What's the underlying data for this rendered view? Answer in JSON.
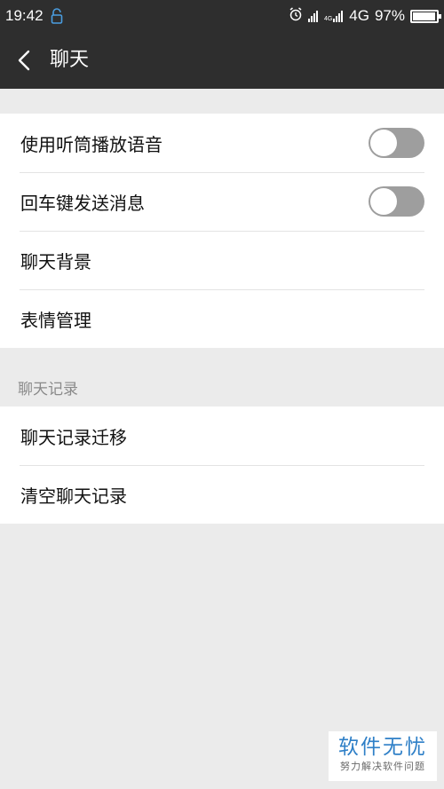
{
  "status_bar": {
    "time": "19:42",
    "network": "4G",
    "tiny_network": "4G",
    "battery": "97%",
    "battery_level": 0.97,
    "icons": [
      "lock-icon",
      "alarm-icon",
      "signal-icon",
      "signal-icon",
      "battery-icon"
    ]
  },
  "header": {
    "title": "聊天",
    "back_icon": "chevron-left-icon"
  },
  "settings": {
    "items": [
      {
        "label": "使用听筒播放语音",
        "toggle": false
      },
      {
        "label": "回车键发送消息",
        "toggle": false
      },
      {
        "label": "聊天背景"
      },
      {
        "label": "表情管理"
      }
    ]
  },
  "chat_history": {
    "section_title": "聊天记录",
    "items": [
      {
        "label": "聊天记录迁移"
      },
      {
        "label": "清空聊天记录"
      }
    ]
  },
  "watermark": {
    "title": "软件无忧",
    "subtitle": "努力解决软件问题"
  },
  "colors": {
    "header_bg": "#2e2e2e",
    "page_bg": "#ebebeb",
    "toggle_off": "#9e9e9e",
    "watermark_blue": "#2e7fc7"
  }
}
